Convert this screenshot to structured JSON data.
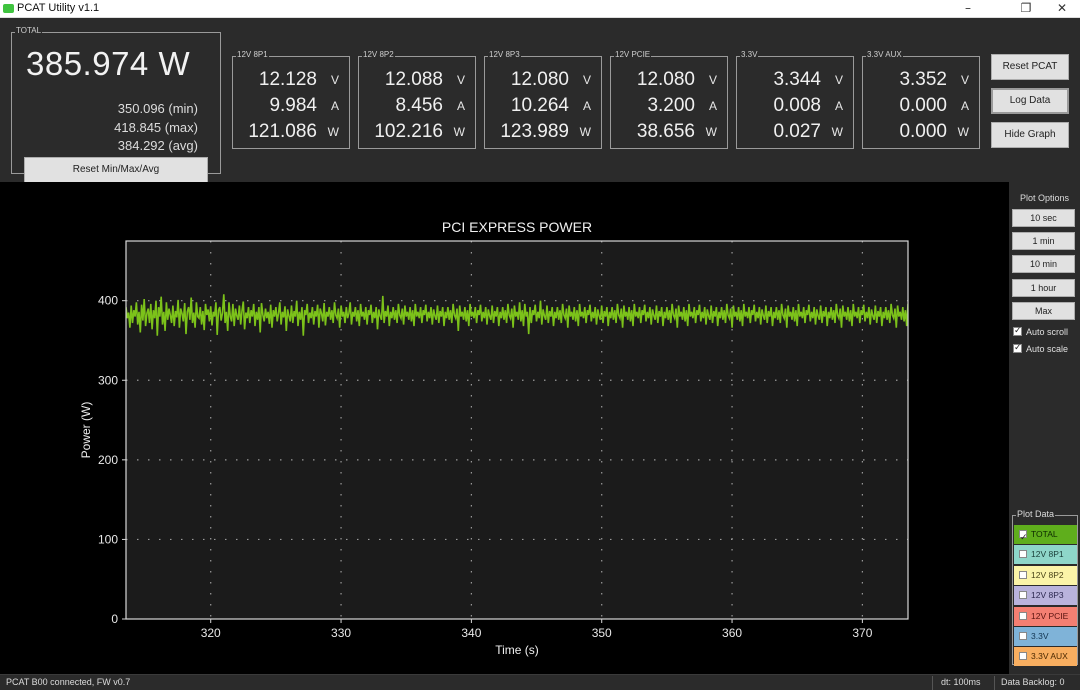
{
  "window": {
    "title": "PCAT Utility v1.1",
    "minimize_icon": "minimize-icon",
    "maximize_icon": "restore-icon",
    "close_icon": "close-icon"
  },
  "total": {
    "label": "TOTAL",
    "value": "385.974 W",
    "min": "350.096 (min)",
    "max": "418.845 (max)",
    "avg": "384.292 (avg)",
    "reset_button": "Reset Min/Max/Avg"
  },
  "rails": [
    {
      "label": "12V 8P1",
      "voltage": "12.128",
      "current": "9.984",
      "power": "121.086"
    },
    {
      "label": "12V 8P2",
      "voltage": "12.088",
      "current": "8.456",
      "power": "102.216"
    },
    {
      "label": "12V 8P3",
      "voltage": "12.080",
      "current": "10.264",
      "power": "123.989"
    },
    {
      "label": "12V PCIE",
      "voltage": "12.080",
      "current": "3.200",
      "power": "38.656"
    },
    {
      "label": "3.3V",
      "voltage": "3.344",
      "current": "0.008",
      "power": "0.027"
    },
    {
      "label": "3.3V AUX",
      "voltage": "3.352",
      "current": "0.000",
      "power": "0.000"
    }
  ],
  "units": {
    "voltage": "V",
    "current": "A",
    "power": "W"
  },
  "actions": {
    "reset_pcat": "Reset PCAT",
    "log_data": "Log Data",
    "hide_graph": "Hide Graph"
  },
  "plot_options": {
    "title": "Plot Options",
    "buttons": [
      "10 sec",
      "1 min",
      "10 min",
      "1 hour",
      "Max"
    ],
    "auto_scroll": {
      "label": "Auto scroll",
      "checked": true
    },
    "auto_scale": {
      "label": "Auto scale",
      "checked": true
    }
  },
  "plot_data": {
    "title": "Plot Data",
    "items": [
      {
        "label": "TOTAL",
        "checked": true,
        "bg": "#5fae1c",
        "fg": "#0d2a00"
      },
      {
        "label": "12V 8P1",
        "checked": false,
        "bg": "#8ed6c9",
        "fg": "#1a3d38"
      },
      {
        "label": "12V 8P2",
        "checked": false,
        "bg": "#fbf4a8",
        "fg": "#4a4418"
      },
      {
        "label": "12V 8P3",
        "checked": false,
        "bg": "#b9b3dc",
        "fg": "#2c2850"
      },
      {
        "label": "12V PCIE",
        "checked": false,
        "bg": "#f47f72",
        "fg": "#5a1410"
      },
      {
        "label": "3.3V",
        "checked": false,
        "bg": "#7fb3d8",
        "fg": "#123450"
      },
      {
        "label": "3.3V AUX",
        "checked": false,
        "bg": "#f8ae60",
        "fg": "#4a2800"
      }
    ]
  },
  "status": {
    "connection": "PCAT B00 connected, FW v0.7",
    "dt": "dt: 100ms",
    "backlog": "Data Backlog: 0"
  },
  "chart_data": {
    "type": "line",
    "title": "PCI EXPRESS POWER",
    "xlabel": "Time (s)",
    "ylabel": "Power (W)",
    "xlim": [
      313.5,
      373.5
    ],
    "ylim": [
      0,
      475
    ],
    "xticks": [
      320,
      330,
      340,
      350,
      360,
      370
    ],
    "yticks": [
      0,
      100,
      200,
      300,
      400
    ],
    "grid": true,
    "line_color": "#7cc21a",
    "series": [
      {
        "name": "TOTAL",
        "x_start": 313.5,
        "x_step": 0.1,
        "values_summary": {
          "min": 350.096,
          "max": 418.845,
          "avg": 384.292
        },
        "values": [
          392,
          378,
          385,
          366,
          394,
          372,
          388,
          380,
          398,
          370,
          386,
          360,
          395,
          375,
          402,
          368,
          384,
          390,
          372,
          396,
          364,
          388,
          378,
          400,
          356,
          392,
          380,
          405,
          370,
          386,
          362,
          398,
          376,
          390,
          382,
          372,
          394,
          368,
          387,
          379,
          401,
          366,
          390,
          384,
          374,
          397,
          358,
          386,
          392,
          376,
          404,
          372,
          385,
          366,
          398,
          380,
          378,
          392,
          370,
          387,
          363,
          396,
          382,
          389,
          374,
          393,
          369,
          386,
          380,
          398,
          357,
          388,
          392,
          375,
          384,
          408,
          372,
          386,
          362,
          398,
          380,
          374,
          396,
          368,
          390,
          381,
          376,
          394,
          370,
          387,
          399,
          364,
          385,
          378,
          392,
          372,
          388,
          380,
          396,
          368,
          386,
          376,
          392,
          360,
          397,
          382,
          374,
          390,
          378,
          386,
          371,
          395,
          366,
          388,
          380,
          392,
          374,
          384,
          398,
          370,
          386,
          379,
          393,
          362,
          389,
          381,
          374,
          394,
          372,
          387,
          380,
          400,
          368,
          386,
          376,
          392,
          356,
          388,
          382,
          396,
          372,
          385,
          378,
          392,
          370,
          387,
          380,
          395,
          366,
          390,
          384,
          374,
          397,
          369,
          386,
          380,
          392,
          376,
          388,
          372,
          398,
          382,
          378,
          390,
          366,
          394,
          380,
          386,
          372,
          392,
          378,
          384,
          398,
          370,
          386,
          380,
          392,
          374,
          388,
          368,
          396,
          380,
          386,
          376,
          392,
          370,
          388,
          382,
          395,
          372,
          386,
          378,
          392,
          364,
          389,
          381,
          376,
          406,
          372,
          387,
          380,
          394,
          368,
          386,
          378,
          392,
          376,
          388,
          372,
          396,
          382,
          378,
          390,
          370,
          394,
          380,
          386,
          376,
          392,
          374,
          388,
          368,
          396,
          380,
          386,
          378,
          392,
          372,
          388,
          382,
          395,
          374,
          386,
          378,
          392,
          370,
          389,
          381,
          376,
          394,
          372,
          387,
          380,
          392,
          368,
          386,
          378,
          392,
          376,
          388,
          372,
          396,
          382,
          378,
          390,
          362,
          394,
          380,
          386,
          376,
          392,
          374,
          388,
          368,
          396,
          380,
          386,
          378,
          392,
          372,
          388,
          382,
          395,
          374,
          386,
          378,
          392,
          370,
          389,
          381,
          376,
          394,
          372,
          387,
          380,
          392,
          368,
          386,
          378,
          392,
          376,
          388,
          372,
          396,
          382,
          378,
          390,
          366,
          394,
          380,
          386,
          376,
          398,
          374,
          388,
          368,
          396,
          380,
          386,
          358,
          392,
          372,
          388,
          382,
          395,
          374,
          386,
          378,
          400,
          370,
          389,
          381,
          376,
          394,
          372,
          387,
          380,
          392,
          368,
          386,
          378,
          392,
          376,
          388,
          372,
          396,
          382,
          378,
          390,
          366,
          394,
          380,
          386,
          376,
          392,
          374,
          388,
          368,
          396,
          380,
          386,
          378,
          392,
          372,
          388,
          382,
          395,
          374,
          386,
          378,
          392,
          370,
          389,
          381,
          376,
          394,
          372,
          387,
          380,
          392,
          368,
          386,
          378,
          392,
          376,
          388,
          372,
          396,
          382,
          378,
          390,
          366,
          394,
          380,
          386,
          376,
          392,
          374,
          388,
          368,
          396,
          380,
          386,
          378,
          392,
          372,
          388,
          382,
          395,
          374,
          386,
          378,
          392,
          370,
          389,
          381,
          376,
          394,
          372,
          387,
          380,
          392,
          368,
          386,
          378,
          392,
          376,
          388,
          372,
          396,
          382,
          378,
          390,
          366,
          394,
          380,
          386,
          376,
          392,
          374,
          388,
          368,
          396,
          380,
          386,
          378,
          392,
          372,
          388,
          382,
          395,
          374,
          386,
          378,
          392,
          370,
          389,
          381,
          376,
          394,
          372,
          387,
          380,
          392,
          368,
          386,
          378,
          392,
          376,
          388,
          372,
          396,
          382,
          378,
          390,
          366,
          394,
          380,
          386,
          376,
          392,
          374,
          388,
          368,
          396,
          380,
          386,
          378,
          392,
          372,
          388,
          382,
          395,
          374,
          386,
          378,
          392,
          370,
          389,
          381,
          376,
          394,
          372,
          387,
          380,
          392,
          368,
          386,
          378,
          392,
          376,
          388,
          372,
          396,
          382,
          378,
          390,
          366,
          394,
          380,
          386,
          376,
          392,
          374,
          388,
          368,
          396,
          380,
          386,
          378,
          392,
          372,
          388,
          382,
          395,
          374,
          386,
          378,
          392,
          370,
          389,
          381,
          376,
          394,
          372,
          387,
          380,
          392,
          368,
          386,
          378,
          392,
          376,
          388,
          372,
          396,
          382,
          378,
          390,
          366,
          394,
          380,
          386,
          376,
          392,
          374,
          388,
          368,
          396,
          380,
          386,
          378,
          392,
          372,
          388,
          382,
          395,
          374,
          386,
          378,
          392,
          370,
          389,
          381,
          376,
          394,
          372,
          387,
          380,
          392,
          368,
          386,
          378,
          392,
          376,
          388,
          372,
          396,
          382,
          378,
          390,
          366,
          394,
          380,
          386,
          376,
          392,
          374,
          388,
          368,
          396,
          380,
          386,
          378,
          392,
          372,
          388,
          382,
          395,
          374,
          386,
          378,
          392,
          370,
          389,
          381,
          376,
          394,
          372,
          387,
          380,
          392,
          368,
          386,
          378,
          392,
          376,
          388,
          372,
          396,
          382,
          378,
          390,
          366,
          394,
          380,
          386,
          376,
          392,
          374,
          388,
          368,
          396,
          380,
          386,
          378,
          392,
          372,
          388,
          382,
          395,
          374,
          386,
          378,
          392
        ]
      }
    ]
  }
}
